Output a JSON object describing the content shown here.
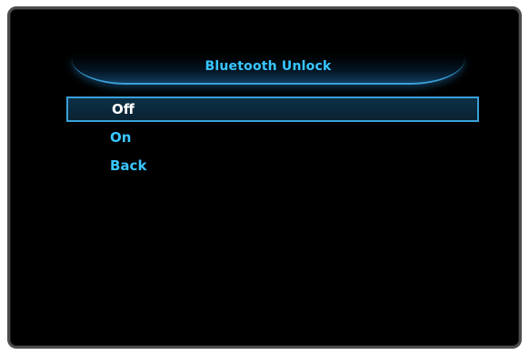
{
  "dialog": {
    "title": "Bluetooth Unlock"
  },
  "menu": {
    "items": [
      {
        "label": "Off",
        "selected": true
      },
      {
        "label": "On",
        "selected": false
      },
      {
        "label": "Back",
        "selected": false
      }
    ]
  },
  "colors": {
    "accent": "#38c6ff",
    "selection_border": "#3aa0d8",
    "background": "#000000"
  }
}
